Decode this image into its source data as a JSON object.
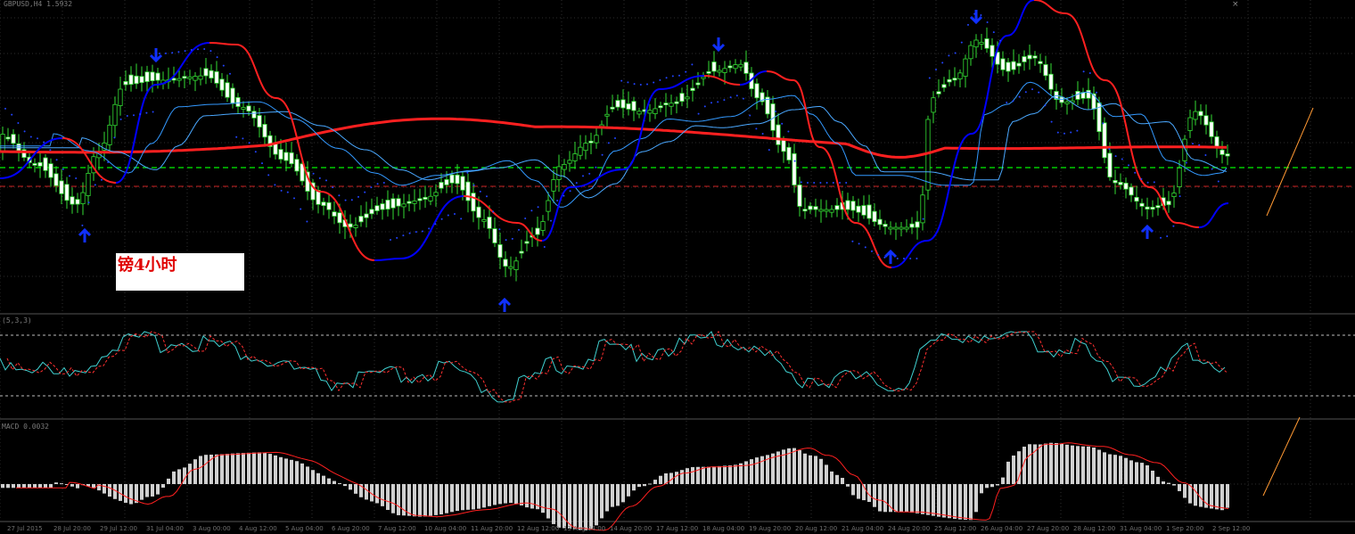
{
  "chart_data": [
    {
      "type": "candlestick",
      "panel": "main",
      "title": "",
      "annotation_label": "镑4小时",
      "header_text": "GBPUSD,H4 1.5932",
      "indicators": [
        "moving averages (red thick, light-blue, blue)",
        "parabolic SAR (blue dots)",
        "up/down arrows"
      ],
      "line_colors": {
        "candle_up": "#33dd33",
        "candle_body": "#ffffff",
        "ma_slow": "#ff2020",
        "ma_fast_a": "#3399ff",
        "ma_fast_b": "#0000ff",
        "sar": "#2244ff",
        "hline_green": "#00cc00",
        "hline_red": "#cc2222"
      },
      "grid": true
    },
    {
      "type": "line",
      "panel": "stochastic",
      "header_text": "(5,3,3)",
      "series_colors": [
        "#40d0d0",
        "#ff3030"
      ],
      "levels": [
        80,
        20
      ]
    },
    {
      "type": "bar",
      "panel": "macd",
      "header_text": "MACD 0.0032",
      "series_colors": [
        "#d0d0d0",
        "#ff2020"
      ]
    }
  ],
  "x_tick_labels": [
    "27 Jul 2015",
    "28 Jul 20:00",
    "29 Jul 12:00",
    "31 Jul 04:00",
    "3 Aug 00:00",
    "4 Aug 12:00",
    "5 Aug 04:00",
    "6 Aug 20:00",
    "7 Aug 12:00",
    "10 Aug 04:00",
    "11 Aug 20:00",
    "12 Aug 12:00",
    "13 Aug 04:00",
    "14 Aug 20:00",
    "17 Aug 12:00",
    "18 Aug 04:00",
    "19 Aug 20:00",
    "20 Aug 12:00",
    "21 Aug 04:00",
    "24 Aug 20:00",
    "25 Aug 12:00",
    "26 Aug 04:00",
    "27 Aug 20:00",
    "28 Aug 12:00",
    "31 Aug 04:00",
    "1 Sep 20:00",
    "2 Sep 12:00"
  ],
  "close_glyph": "×"
}
